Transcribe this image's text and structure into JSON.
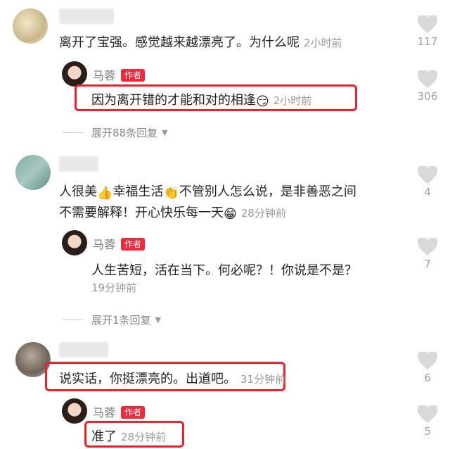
{
  "comments": [
    {
      "text": "离开了宝强。感觉越来越漂亮了。为什么呢",
      "time": "2小时前",
      "likes": "117",
      "reply": {
        "author": "马蓉",
        "badge": "作者",
        "text": "因为离开错的才能和对的相逢",
        "emoji": "😏",
        "time": "2小时前",
        "likes": "306"
      },
      "expand": "展开88条回复"
    },
    {
      "text_line1_a": "人很美",
      "emoji1": "👍",
      "text_line1_b": "幸福生活",
      "emoji2": "👏",
      "text_line1_c": "不管别人怎么说，是非善恶之间",
      "text_line2": "不需要解释！开心快乐每一天",
      "emoji3": "😁",
      "time": "28分钟前",
      "likes": "4",
      "reply": {
        "author": "马蓉",
        "badge": "作者",
        "text": "人生苦短，活在当下。何必呢？！你说是不是？",
        "time": "19分钟前",
        "likes": "7"
      },
      "expand": "展开1条回复"
    },
    {
      "text": "说实话，你挺漂亮的。出道吧。",
      "time": "31分钟前",
      "likes": "6",
      "reply": {
        "author": "马蓉",
        "badge": "作者",
        "text": "准了",
        "time": "28分钟前",
        "likes": "5"
      }
    }
  ],
  "colors": {
    "highlight": "#e8232e",
    "badge": "#f0283c",
    "muted": "#9a9a9a",
    "heart": "#d9d9d9"
  }
}
